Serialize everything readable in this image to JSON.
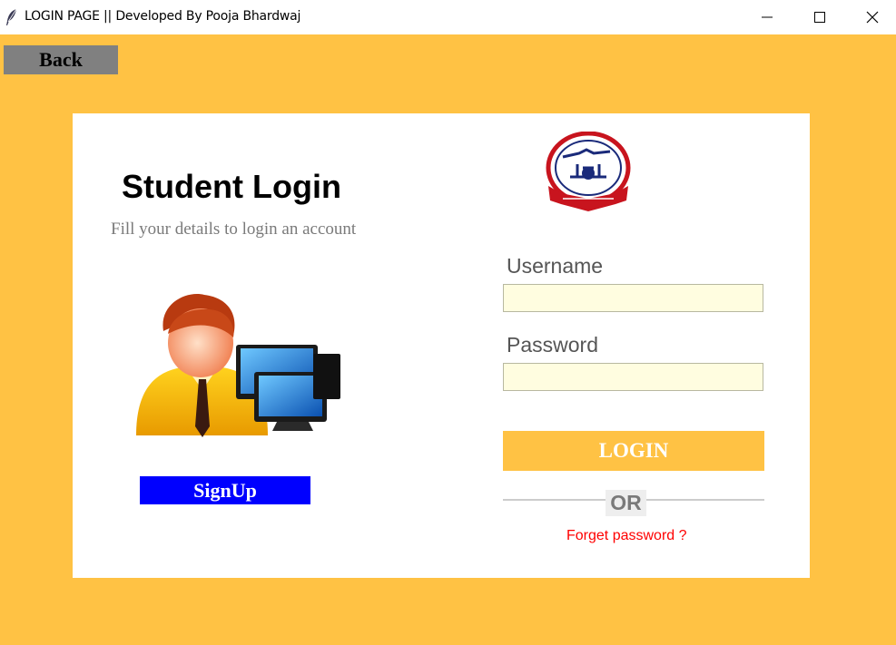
{
  "window": {
    "title": "LOGIN PAGE || Developed By Pooja Bhardwaj",
    "app_icon": "feather-icon",
    "controls": [
      "minimize-icon",
      "maximize-icon",
      "close-icon"
    ]
  },
  "back_button": {
    "label": "Back"
  },
  "login_card": {
    "heading": "Student Login",
    "subheading": "Fill your details to login an account",
    "illustration": "user-computer-icon",
    "signup_label": "SignUp",
    "logo": "college-emblem-icon",
    "username_label": "Username",
    "username_value": "",
    "password_label": "Password",
    "password_value": "",
    "login_label": "LOGIN",
    "divider_text": "OR",
    "forget_label": "Forget password ?"
  },
  "colors": {
    "background": "#ffc244",
    "card": "#ffffff",
    "back_button": "#808080",
    "signup": "#0000ff",
    "login": "#ffc244",
    "input": "#fffde0",
    "forget_link": "#ff0000"
  }
}
